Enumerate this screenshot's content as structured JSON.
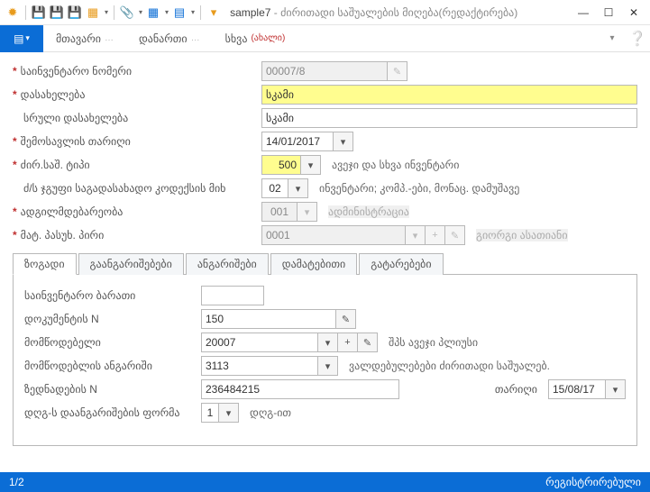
{
  "window": {
    "doc_name": "sample7",
    "title_suffix": "ძირითადი საშუალების მიღება(რედაქტირება)"
  },
  "menus": {
    "main": "მთავარი",
    "attachment": "დანართი",
    "other_base": "სხვა",
    "other_new": "(ახალი)"
  },
  "fields": {
    "inv_number_label": "საინვენტარო ნომერი",
    "inv_number_value": "00007/8",
    "name_label": "დასახელება",
    "name_value": "სკამი",
    "full_name_label": "სრული დასახელება",
    "full_name_value": "სკამი",
    "income_date_label": "შემოსავლის თარიღი",
    "income_date_value": "14/01/2017",
    "asset_type_label": "ძირ.საშ. ტიპი",
    "asset_type_code": "500",
    "asset_type_text": "ავეჯი და სხვა ინვენტარი",
    "tax_group_label": "ძ/ს ჯგუფი საგადასახადო კოდექსის მიხ",
    "tax_group_code": "02",
    "tax_group_text": "ინვენტარი; კომპ.-ები, მონაც. დამუშავე",
    "location_label": "ადგილმდებარეობა",
    "location_code": "001",
    "location_text": "ადმინისტრაცია",
    "responsible_label": "მატ. პასუხ. პირი",
    "responsible_code": "0001",
    "responsible_text": "გიორგი ასათიანი"
  },
  "tabs": {
    "general": "ზოგადი",
    "calculations": "გაანგარიშებები",
    "accounts": "ანგარიშები",
    "additional": "დამატებითი",
    "movements": "გატარებები"
  },
  "general_tab": {
    "inv_card_label": "საინვენტარო ბარათი",
    "inv_card_value": "",
    "doc_n_label": "დოკუმენტის N",
    "doc_n_value": "150",
    "supplier_label": "მომწოდებელი",
    "supplier_code": "20007",
    "supplier_text": "შპს ავეჯი პლიუსი",
    "supplier_acc_label": "მომწოდებლის ანგარიში",
    "supplier_acc_code": "3113",
    "supplier_acc_text": "ვალდებულებები ძირითადი საშუალებ.",
    "waybill_label": "ზედნადების N",
    "waybill_value": "236484215",
    "date_label": "თარიღი",
    "date_value": "15/08/17",
    "vat_form_label": "დღგ-ს დაანგარიშების ფორმა",
    "vat_form_value": "1",
    "vat_form_text": "დღგ-ით"
  },
  "status": {
    "page": "1/2",
    "state": "რეგისტრირებული"
  }
}
